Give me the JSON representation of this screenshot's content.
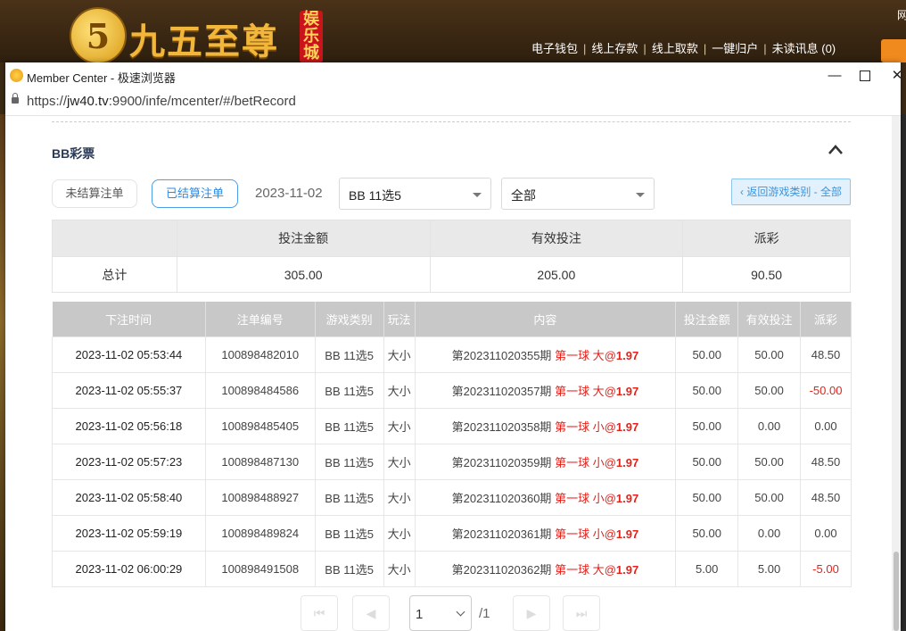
{
  "site": {
    "logo_digit": "5",
    "logo_text": "九五至尊",
    "logo_badge": "娱乐城",
    "nav": [
      "电子钱包",
      "线上存款",
      "线上取款",
      "一键归户",
      "未读讯息 (0)"
    ],
    "nav_separator": "|",
    "top_right_char": "网"
  },
  "window": {
    "title": "Member Center - 极速浏览器",
    "url_prefix": "https://",
    "url_host": "jw40.tv",
    "url_rest": ":9900/infe/mcenter/#/betRecord",
    "min_label": "—",
    "close_label": "✕"
  },
  "section": {
    "title": "BB彩票"
  },
  "filters": {
    "unsettled_label": "未结算注单",
    "settled_label": "已结算注单",
    "date": "2023-11-02",
    "game_select": "BB 11选5",
    "type_select": "全部",
    "back_label": "‹ 返回游戏类别 - 全部"
  },
  "summary": {
    "headers": [
      "",
      "投注金额",
      "有效投注",
      "派彩"
    ],
    "row_label": "总计",
    "bet_amount": "305.00",
    "valid_bet": "205.00",
    "payout": "90.50"
  },
  "records": {
    "headers": [
      "下注时间",
      "注单编号",
      "游戏类别",
      "玩法",
      "内容",
      "投注金额",
      "有效投注",
      "派彩"
    ],
    "rows": [
      {
        "time": "2023-11-02 05:53:44",
        "id": "100898482010",
        "game": "BB 11选5",
        "play": "大小",
        "period": "第202311020355期",
        "pick": "第一球 大",
        "odds": "1.97",
        "bet": "50.00",
        "valid": "50.00",
        "payout": "48.50"
      },
      {
        "time": "2023-11-02 05:55:37",
        "id": "100898484586",
        "game": "BB 11选5",
        "play": "大小",
        "period": "第202311020357期",
        "pick": "第一球 大",
        "odds": "1.97",
        "bet": "50.00",
        "valid": "50.00",
        "payout": "-50.00"
      },
      {
        "time": "2023-11-02 05:56:18",
        "id": "100898485405",
        "game": "BB 11选5",
        "play": "大小",
        "period": "第202311020358期",
        "pick": "第一球 小",
        "odds": "1.97",
        "bet": "50.00",
        "valid": "0.00",
        "payout": "0.00"
      },
      {
        "time": "2023-11-02 05:57:23",
        "id": "100898487130",
        "game": "BB 11选5",
        "play": "大小",
        "period": "第202311020359期",
        "pick": "第一球 小",
        "odds": "1.97",
        "bet": "50.00",
        "valid": "50.00",
        "payout": "48.50"
      },
      {
        "time": "2023-11-02 05:58:40",
        "id": "100898488927",
        "game": "BB 11选5",
        "play": "大小",
        "period": "第202311020360期",
        "pick": "第一球 小",
        "odds": "1.97",
        "bet": "50.00",
        "valid": "50.00",
        "payout": "48.50"
      },
      {
        "time": "2023-11-02 05:59:19",
        "id": "100898489824",
        "game": "BB 11选5",
        "play": "大小",
        "period": "第202311020361期",
        "pick": "第一球 小",
        "odds": "1.97",
        "bet": "50.00",
        "valid": "0.00",
        "payout": "0.00"
      },
      {
        "time": "2023-11-02 06:00:29",
        "id": "100898491508",
        "game": "BB 11选5",
        "play": "大小",
        "period": "第202311020362期",
        "pick": "第一球 大",
        "odds": "1.97",
        "bet": "5.00",
        "valid": "5.00",
        "payout": "-5.00"
      }
    ]
  },
  "pagination": {
    "first_icon": "double-left-icon",
    "prev_icon": "left-icon",
    "next_icon": "right-icon",
    "last_icon": "double-right-icon",
    "current_page": "1",
    "total": "/1"
  },
  "colors": {
    "accent_blue": "#2f8be0",
    "highlight_red": "#e0231c",
    "header_gray": "#c8c8c8"
  }
}
